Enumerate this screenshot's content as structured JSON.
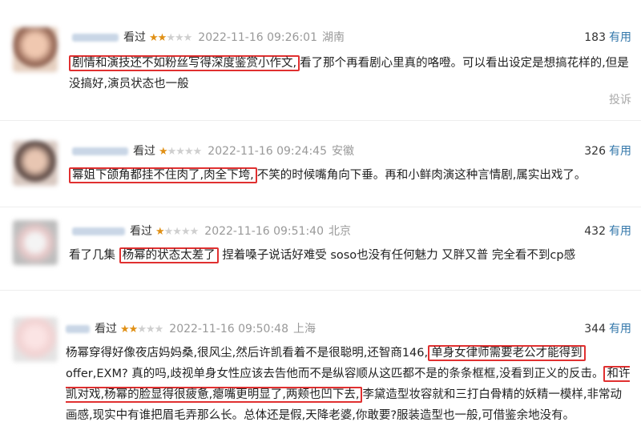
{
  "reviews": [
    {
      "status": "看过",
      "rating": 2,
      "datetime": "2022-11-16 09:26:01",
      "location": "湖南",
      "useful_count": "183",
      "useful_label": "有用",
      "highlight": "剧情和演技还不如粉丝写得深度鉴赏小作文,",
      "text_after": "看了那个再看剧心里真的咯噔。可以看出设定是想搞花样的,但是没搞好,演员状态也一般",
      "report_label": "投诉"
    },
    {
      "status": "看过",
      "rating": 1,
      "datetime": "2022-11-16 09:24:45",
      "location": "安徽",
      "useful_count": "326",
      "useful_label": "有用",
      "highlight": "幂姐下颌角都挂不住肉了,肉全下垮,",
      "text_after": "不笑的时候嘴角向下垂。再和小鲜肉演这种言情剧,属实出戏了。"
    },
    {
      "status": "看过",
      "rating": 1,
      "datetime": "2022-11-16 09:51:40",
      "location": "北京",
      "useful_count": "432",
      "useful_label": "有用",
      "text_before": "看了几集",
      "highlight": "杨幂的状态太差了",
      "text_after": "捏着嗓子说话好难受 soso也没有任何魅力 又胖又普 完全看不到cp感"
    },
    {
      "status": "看过",
      "rating": 2,
      "datetime": "2022-11-16 09:50:48",
      "location": "上海",
      "useful_count": "344",
      "useful_label": "有用",
      "text_1": "杨幂穿得好像夜店妈妈桑,很风尘,然后许凯看着不是很聪明,还智商146,",
      "highlight_1": "单身女律师需要老公才能得到",
      "text_2": "offer,EXM? 真的吗,歧视单身女性应该去告他而不是纵容顺从这匹都不是的条条框框,没看到正义的反击。",
      "highlight_2": "和许凯对戏,杨幂的脸显得很疲惫,瘪嘴更明显了,两颊也凹下去,",
      "text_3": "李黛造型妆容就和三打白骨精的妖精一模样,非常动画感,现实中有谁把眉毛弄那么长。总体还是假,天降老婆,你敢要?服装造型也一般,可借鉴余地没有。"
    }
  ],
  "colors": {
    "star": "#e09015",
    "useful": "#3377aa",
    "highlight_border": "#e03030"
  }
}
